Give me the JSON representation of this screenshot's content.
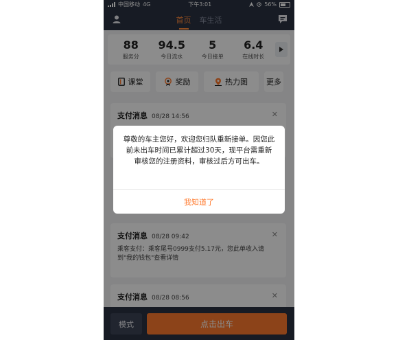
{
  "status_bar": {
    "carrier": "中国移动",
    "network": "4G",
    "time": "下午3:01",
    "battery": "56%"
  },
  "nav": {
    "tabs": [
      {
        "label": "首页",
        "active": true
      },
      {
        "label": "车生活",
        "active": false
      }
    ]
  },
  "stats": [
    {
      "value": "88",
      "label": "服务分"
    },
    {
      "value": "94.5",
      "label": "今日流水"
    },
    {
      "value": "5",
      "label": "今日接单"
    },
    {
      "value": "6.4",
      "label": "在线时长"
    }
  ],
  "quick_actions": [
    {
      "label": "课堂",
      "icon": "book-icon"
    },
    {
      "label": "奖励",
      "icon": "medal-icon"
    },
    {
      "label": "热力图",
      "icon": "location-pin-icon"
    },
    {
      "label": "更多"
    }
  ],
  "messages": [
    {
      "title": "支付消息",
      "time": "08/28 14:56",
      "body": ""
    },
    {
      "title": "支付消息",
      "time": "08/28 09:42",
      "body": "乘客支付：乘客尾号0999支付5.17元，您此单收入请到\"我的钱包\"查看详情"
    },
    {
      "title": "支付消息",
      "time": "08/28 08:56",
      "body": ""
    }
  ],
  "bottom": {
    "mode_label": "模式",
    "go_label": "点击出车"
  },
  "dialog": {
    "message": "尊敬的车主您好，欢迎您归队重新接单。因您此前未出车时间已累计超过30天，现平台需重新审核您的注册资料，审核过后方可出车。",
    "confirm_label": "我知道了"
  },
  "colors": {
    "accent": "#ff7a2e",
    "header_bg": "#2b3242"
  }
}
